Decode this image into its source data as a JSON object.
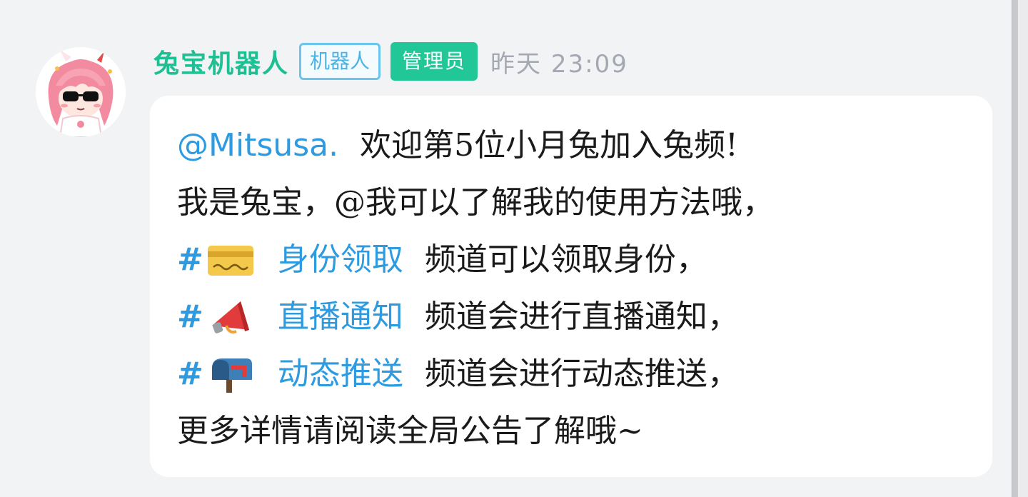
{
  "message": {
    "author": "兔宝机器人",
    "badges": {
      "bot": "机器人",
      "admin": "管理员"
    },
    "timestamp": "昨天 23:09",
    "lines": {
      "l1": {
        "mention": "@Mitsusa.",
        "text": "欢迎第5位小月兔加入兔频!"
      },
      "l2": {
        "text": "我是兔宝，@我可以了解我的使用方法哦，"
      },
      "l3": {
        "hash": "#",
        "icon": "credit-card-icon",
        "channel": "身份领取",
        "text": "频道可以领取身份，"
      },
      "l4": {
        "hash": "#",
        "icon": "megaphone-icon",
        "channel": "直播通知",
        "text": "频道会进行直播通知，"
      },
      "l5": {
        "hash": "#",
        "icon": "mailbox-icon",
        "channel": "动态推送",
        "text": "频道会进行动态推送，"
      },
      "l6": {
        "text": "更多详情请阅读全局公告了解哦~"
      }
    }
  },
  "colors": {
    "author": "#1fbf94",
    "admin_badge": "#22c797",
    "bot_badge": "#4ab3e3",
    "link": "#2e9be0",
    "timestamp": "#a5a8b3",
    "background": "#f2f3f5",
    "bubble": "#ffffff"
  }
}
